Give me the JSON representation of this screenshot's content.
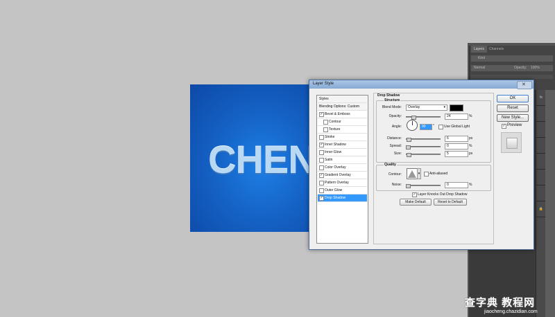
{
  "canvas": {
    "text": "CHENA"
  },
  "right_panel": {
    "tabs": [
      "Layers",
      "Channels"
    ],
    "kind_label": "Kind",
    "blend_label": "Normal",
    "opacity_label": "Opacity:",
    "opacity_value": "100%",
    "fx_label": "fx"
  },
  "dialog": {
    "title": "Layer Style",
    "styles_list": [
      {
        "label": "Styles",
        "type": "header"
      },
      {
        "label": "Blending Options: Custom",
        "type": "header"
      },
      {
        "label": "Bevel & Emboss",
        "checked": true
      },
      {
        "label": "Contour",
        "checked": false,
        "indent": true
      },
      {
        "label": "Texture",
        "checked": false,
        "indent": true
      },
      {
        "label": "Stroke",
        "checked": false
      },
      {
        "label": "Inner Shadow",
        "checked": true
      },
      {
        "label": "Inner Glow",
        "checked": false
      },
      {
        "label": "Satin",
        "checked": false
      },
      {
        "label": "Color Overlay",
        "checked": false
      },
      {
        "label": "Gradient Overlay",
        "checked": true
      },
      {
        "label": "Pattern Overlay",
        "checked": false
      },
      {
        "label": "Outer Glow",
        "checked": false
      },
      {
        "label": "Drop Shadow",
        "checked": true,
        "selected": true
      }
    ],
    "section_title": "Drop Shadow",
    "structure_label": "Structure",
    "blend_mode_label": "Blend Mode:",
    "blend_mode_value": "Overlay",
    "shadow_color": "#000000",
    "opacity_label": "Opacity:",
    "opacity_value": "24",
    "angle_label": "Angle:",
    "angle_value": "90",
    "use_global_light_label": "Use Global Light",
    "distance_label": "Distance:",
    "distance_value": "6",
    "spread_label": "Spread:",
    "spread_value": "0",
    "size_label": "Size:",
    "size_value": "5",
    "quality_label": "Quality",
    "contour_label": "Contour:",
    "anti_aliased_label": "Anti-aliased",
    "noise_label": "Noise:",
    "noise_value": "0",
    "knockout_label": "Layer Knocks Out Drop Shadow",
    "make_default_label": "Make Default",
    "reset_default_label": "Reset to Default",
    "units": {
      "percent": "%",
      "px": "px",
      "degree": "°"
    },
    "ok_label": "OK",
    "reset_label": "Reset",
    "new_style_label": "New Style...",
    "preview_label": "Preview"
  },
  "watermark": {
    "brand": "查字典 教程网",
    "url": "jiaocheng.chazidian.com"
  }
}
